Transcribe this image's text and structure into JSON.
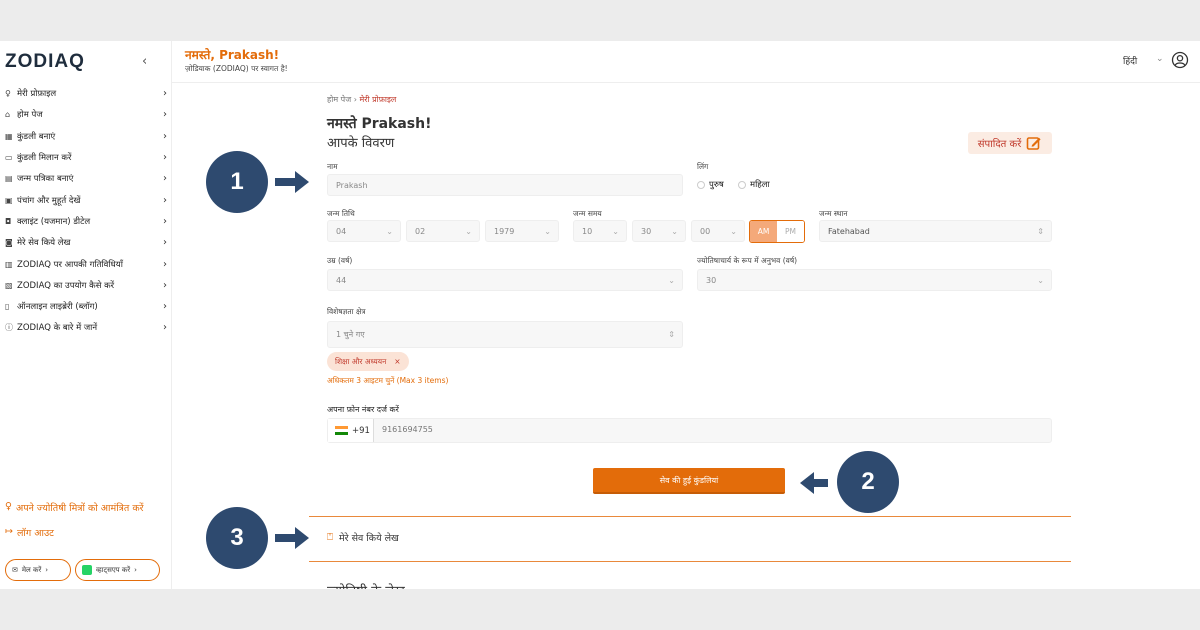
{
  "sidebar": {
    "logo": "ZODIAQ",
    "collapse_icon": "‹",
    "items": [
      {
        "icon": "user-icon",
        "glyph": "♀",
        "label": "मेरी प्रोफ़ाइल"
      },
      {
        "icon": "home-icon",
        "glyph": "⌂",
        "label": "होम पेज"
      },
      {
        "icon": "kundli-icon",
        "glyph": "▦",
        "label": "कुंडली बनाएं"
      },
      {
        "icon": "match-icon",
        "glyph": "▭",
        "label": "कुंडली मिलान करें"
      },
      {
        "icon": "document-icon",
        "glyph": "▤",
        "label": "जन्म पत्रिका बनाएं"
      },
      {
        "icon": "calendar-icon",
        "glyph": "▣",
        "label": "पंचांग और मुहूर्त देखें"
      },
      {
        "icon": "client-icon",
        "glyph": "◘",
        "label": "क्लाइंट (यजमान) डीटेल"
      },
      {
        "icon": "bookmark-icon",
        "glyph": "◙",
        "label": "मेरे सेव किये लेख"
      },
      {
        "icon": "activity-icon",
        "glyph": "▥",
        "label": "ZODIAQ पर आपकी गतिविधियाँ"
      },
      {
        "icon": "guide-icon",
        "glyph": "▧",
        "label": "ZODIAQ का उपयोग कैसे करें"
      },
      {
        "icon": "library-icon",
        "glyph": "▯",
        "label": "ऑनलाइन लाइब्रेरी (ब्लॉग)"
      },
      {
        "icon": "info-icon",
        "glyph": "ⓘ",
        "label": "ZODIAQ के बारे में जानें"
      }
    ],
    "invite": "अपने ज्योतिषी मित्रों को आमंत्रित करें",
    "logout": "लॉग आउट",
    "mail_label": "मेल करें",
    "whatsapp_label": "व्हाट्सएप करें"
  },
  "header": {
    "greeting": "नमस्ते, Prakash!",
    "welcome": "ज़ोडियाक (ZODIAQ) पर स्वागत है!",
    "language": "हिंदी"
  },
  "profile": {
    "breadcrumb_home": "होम पेज",
    "breadcrumb_current": "मेरी प्रोफ़ाइल",
    "title": "नमस्ते Prakash!",
    "subtitle": "आपके विवरण",
    "edit_label": "संपादित करें",
    "name_label": "नाम",
    "name_value": "Prakash",
    "gender_label": "लिंग",
    "gender_male": "पुरुष",
    "gender_female": "महिला",
    "dob_label": "जन्म तिथि",
    "dob_day": "04",
    "dob_month": "02",
    "dob_year": "1979",
    "tob_label": "जन्म समय",
    "tob_hour": "10",
    "tob_min": "30",
    "tob_sec": "00",
    "am": "AM",
    "pm": "PM",
    "pob_label": "जन्म स्थान",
    "pob_value": "Fatehabad",
    "age_label": "उम्र (वर्ष)",
    "age_value": "44",
    "exp_label": "ज्योतिषाचार्य के रूप में अनुभव (वर्ष)",
    "exp_value": "30",
    "specialty_label": "विशेषज्ञता क्षेत्र",
    "specialty_value": "1 चुने गए",
    "chip_label": "शिक्षा और अध्ययन",
    "chip_remove": "×",
    "hint": "अधिकतम 3 आइटम चुनें (Max 3 items)",
    "phone_label": "अपना फ़ोन नंबर दर्ज करें",
    "phone_code": "+91",
    "phone_value": "9161694755",
    "save_label": "सेव की हुई कुंडलियां",
    "saved_articles": "मेरे सेव किये लेख",
    "cut_off_text": "ज्योतिषी के लेख"
  },
  "annotations": [
    "1",
    "2",
    "3"
  ],
  "colors": {
    "accent": "#e36c0a",
    "badge": "#2e4a6f"
  }
}
